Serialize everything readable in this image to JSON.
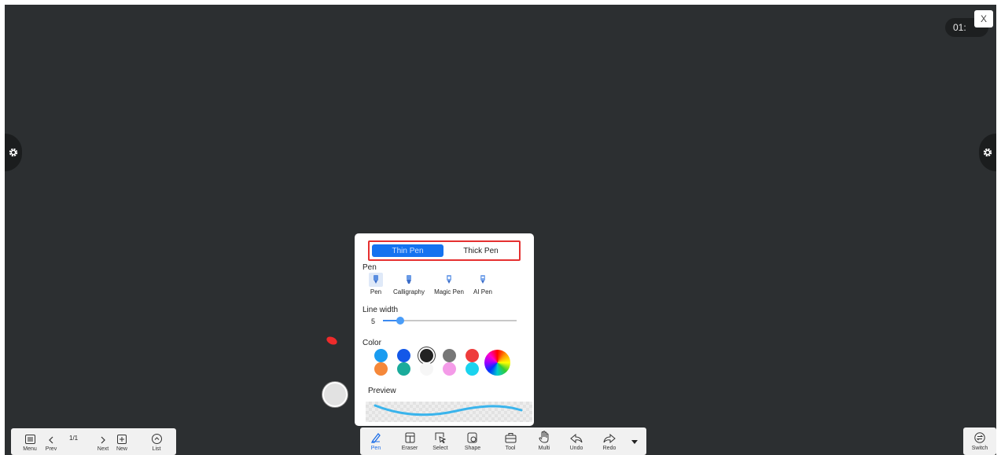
{
  "timer": "01:",
  "close_label": "X",
  "pen_panel": {
    "tabs": [
      {
        "label": "Thin Pen",
        "active": true
      },
      {
        "label": "Thick Pen",
        "active": false
      }
    ],
    "pen_section_label": "Pen",
    "pen_types": [
      {
        "label": "Pen",
        "icon": "pen-icon",
        "active": true
      },
      {
        "label": "Calligraphy",
        "icon": "calligraphy-pen-icon",
        "active": false
      },
      {
        "label": "Magic Pen",
        "icon": "magic-pen-icon",
        "active": false
      },
      {
        "label": "AI Pen",
        "icon": "ai-pen-icon",
        "active": false
      }
    ],
    "line_width_label": "Line width",
    "line_width_value": "5",
    "line_width_fraction": 0.13,
    "color_label": "Color",
    "colors": [
      "#1a9cf0",
      "#1358e8",
      "#222222",
      "#777777",
      "#ee3c3c",
      "#f5883a",
      "#1aab9b",
      "#f6f6f6",
      "#f49be8",
      "#1ad3ee"
    ],
    "selected_color": "#222222",
    "preview_label": "Preview",
    "preview_stroke_color": "#3ab4ec"
  },
  "left_toolbar": {
    "menu_label": "Menu",
    "prev_label": "Prev",
    "page_indicator": "1/1",
    "next_label": "Next",
    "new_label": "New",
    "list_label": "List"
  },
  "main_toolbar": {
    "items": [
      {
        "label": "Pen",
        "icon": "pen-icon",
        "active": true
      },
      {
        "label": "Eraser",
        "icon": "eraser-icon"
      },
      {
        "label": "Select",
        "icon": "select-icon"
      },
      {
        "label": "Shape",
        "icon": "shape-icon"
      },
      {
        "label": "Tool",
        "icon": "toolbox-icon"
      },
      {
        "label": "Multi",
        "icon": "hand-icon"
      },
      {
        "label": "Undo",
        "icon": "undo-icon"
      },
      {
        "label": "Redo",
        "icon": "redo-icon"
      }
    ],
    "more_icon": "triangle-down-icon",
    "active_color": "#1e6fe8"
  },
  "switch_label": "Switch",
  "colors": {
    "board": "#2c2f31",
    "accent": "#1473f0",
    "highlight_border": "#e53030"
  }
}
